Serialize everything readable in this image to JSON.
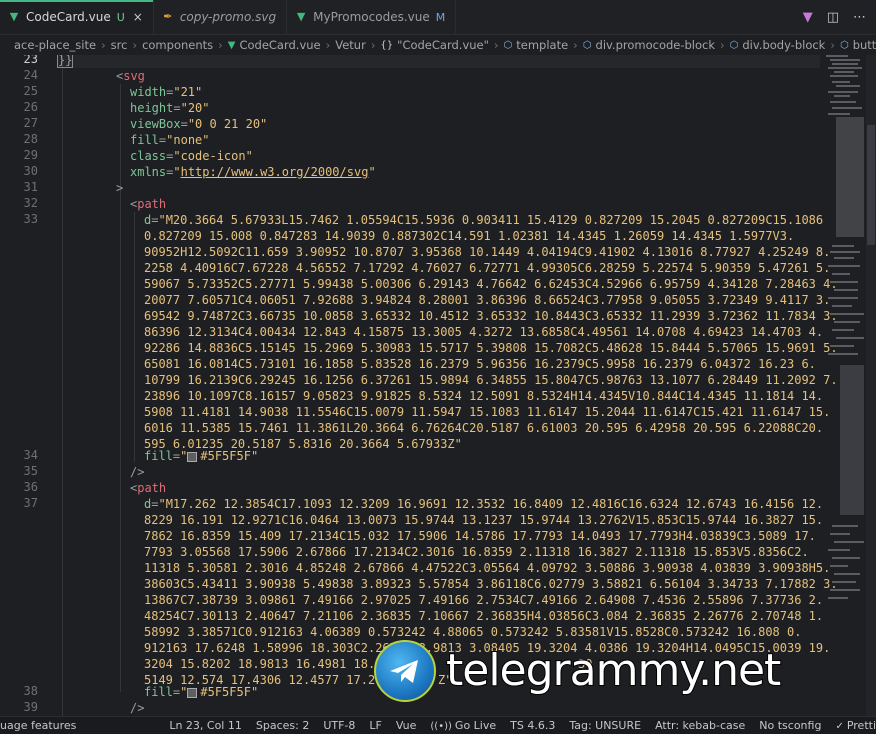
{
  "tabs": [
    {
      "label": "CodeCard.vue",
      "badge": "U",
      "icon": "vue-icon",
      "active": true,
      "italic": false
    },
    {
      "label": "copy-promo.svg",
      "badge": "",
      "icon": "svg-file-icon",
      "active": false,
      "italic": true
    },
    {
      "label": "MyPromocodes.vue",
      "badge": "M",
      "icon": "vue-icon",
      "active": false,
      "italic": false
    }
  ],
  "tab_close_glyph": "×",
  "breadcrumb": [
    "ace-place_site",
    "src",
    "components",
    "CodeCard.vue",
    "Vetur",
    "\"CodeCard.vue\"",
    "template",
    "div.promocode-block",
    "div.body-block",
    "button.promocode"
  ],
  "lines": {
    "l23": "}}",
    "l24_tag": "svg",
    "l25_attr": "width",
    "l25_val": "\"21\"",
    "l26_attr": "height",
    "l26_val": "\"20\"",
    "l27_attr": "viewBox",
    "l27_val": "\"0 0 21 20\"",
    "l28_attr": "fill",
    "l28_val": "\"none\"",
    "l29_attr": "class",
    "l29_val": "\"code-icon\"",
    "l30_attr": "xmlns",
    "l30_q1": "\"",
    "l30_url": "http://www.w3.org/2000/svg",
    "l30_q2": "\"",
    "l31": ">",
    "l32_tag": "path",
    "l33_attr": "d",
    "d1": [
      "\"M20.3664 5.67933L15.7462 1.05594C15.5936 0.903411 15.4129 0.827209 15.2045 0.827209C15.1086",
      "0.827209 15.008 0.847283 14.9039 0.887302C14.591 1.02381 14.4345 1.26059 14.4345 1.5977V3.",
      "90952H12.5092C11.659 3.90952 10.8707 3.95368 10.1449 4.04194C9.41902 4.13016 8.77927 4.25249 8.",
      "2258 4.40916C7.67228 4.56552 7.17292 4.76027 6.72771 4.99305C6.28259 5.22574 5.90359 5.47261 5.",
      "59067 5.73352C5.27771 5.99438 5.00306 6.29143 4.76642 6.62453C4.52966 6.95759 4.34128 7.28463 4.",
      "20077 7.60571C4.06051 7.92688 3.94824 8.28001 3.86396 8.66524C3.77958 9.05055 3.72349 9.4117 3.",
      "69542 9.74872C3.66735 10.0858 3.65332 10.4512 3.65332 10.8443C3.65332 11.2939 3.72362 11.7834 3.",
      "86396 12.3134C4.00434 12.843 4.15875 13.3005 4.3272 13.6858C4.49561 14.0708 4.69423 14.4703 4.",
      "92286 14.8836C5.15145 15.2969 5.30983 15.5717 5.39808 15.7082C5.48628 15.8444 5.57065 15.9691 5.",
      "65081 16.0814C5.73101 16.1858 5.83528 16.2379 5.96356 16.2379C5.9958 16.2379 6.04372 16.23 6.",
      "10799 16.2139C6.29245 16.1256 6.37261 15.9894 6.34855 15.8047C5.98763 13.1077 6.28449 11.2092 7.",
      "23896 10.1097C8.16157 9.05823 9.91825 8.5324 12.5091 8.5324H14.4345V10.844C14.4345 11.1814 14.",
      "5908 11.4181 14.9038 11.5546C15.0079 11.5947 15.1083 11.6147 15.2044 11.6147C15.421 11.6147 15.",
      "6016 11.5385 15.7461 11.3861L20.3664 6.76264C20.5187 6.61003 20.595 6.42958 20.595 6.22088C20.",
      "595 6.01235 20.5187 5.8316 20.3664 5.67933Z\""
    ],
    "fill_attr": "fill",
    "fill_val": "#5F5F5F",
    "l35": "/>",
    "l36_tag": "path",
    "l37_attr": "d",
    "d2": [
      "\"M17.262 12.3854C17.1093 12.3209 16.9691 12.3532 16.8409 12.4816C16.6324 12.6743 16.4156 12.",
      "8229 16.191 12.9271C16.0464 13.0073 15.9744 13.1237 15.9744 13.2762V15.853C15.9744 16.3827 15.",
      "7862 16.8359 15.409 17.2134C15.032 17.5906 14.5786 17.7793 14.0493 17.7793H4.03839C3.5089 17.",
      "7793 3.05568 17.5906 2.67866 17.2134C2.3016 16.8359 2.11318 16.3827 2.11318 15.853V5.8356C2.",
      "11318 5.30581 2.3016 4.85248 2.67866 4.47522C3.05564 4.09792 3.50886 3.90938 4.03839 3.90938H5.",
      "38603C5.43411 3.90938 5.49838 3.89323 5.57854 3.86118C6.02779 3.58821 6.56104 3.34733 7.17882 3.",
      "13867C7.38739 3.09861 7.49166 2.97025 7.49166 2.7534C7.49166 2.64908 7.4536 2.55896 7.37736 2.",
      "48254C7.30113 2.40647 7.21106 2.36835 7.10667 2.36835H4.03856C3.084 2.36835 2.26776 2.70748 1.",
      "58992 3.38571C0.912163 4.06389 0.573242 4.88065 0.573242 5.83581V15.8528C0.573242 16.808 0.",
      "912163 17.6248 1.58996 18.303C2.2678 18.9813 3.08405 19.3204 4.0386 19.3204H14.0495C15.0039 19.",
      "3204 15.8202 18.9813 16.4981 18.3",
      "5149 12.574 17.4306 12.4577 17.26"
    ],
    "d2_tail1": "30",
    "d2_tail2": "Z\"",
    "l39": "/>"
  },
  "line_numbers": [
    23,
    24,
    25,
    26,
    27,
    28,
    29,
    30,
    31,
    32,
    33,
    34,
    35,
    36,
    37,
    38,
    39
  ],
  "status": {
    "language": "uage features",
    "position": "Ln 23, Col 11",
    "spaces": "Spaces: 2",
    "encoding": "UTF-8",
    "eol": "LF",
    "mode": "Vue",
    "golive": "Go Live",
    "ts": "TS 4.6.3",
    "tag": "Tag: UNSURE",
    "attr": "Attr: kebab-case",
    "tsconfig": "No tsconfig",
    "prettier": "Pretti"
  },
  "watermark": "telegrammy.net",
  "colors": {
    "accent_vue": "#42b883",
    "tag": "#e06c75",
    "attribute": "#7ec699",
    "string": "#e5c07b",
    "swatch": "#5F5F5F"
  }
}
